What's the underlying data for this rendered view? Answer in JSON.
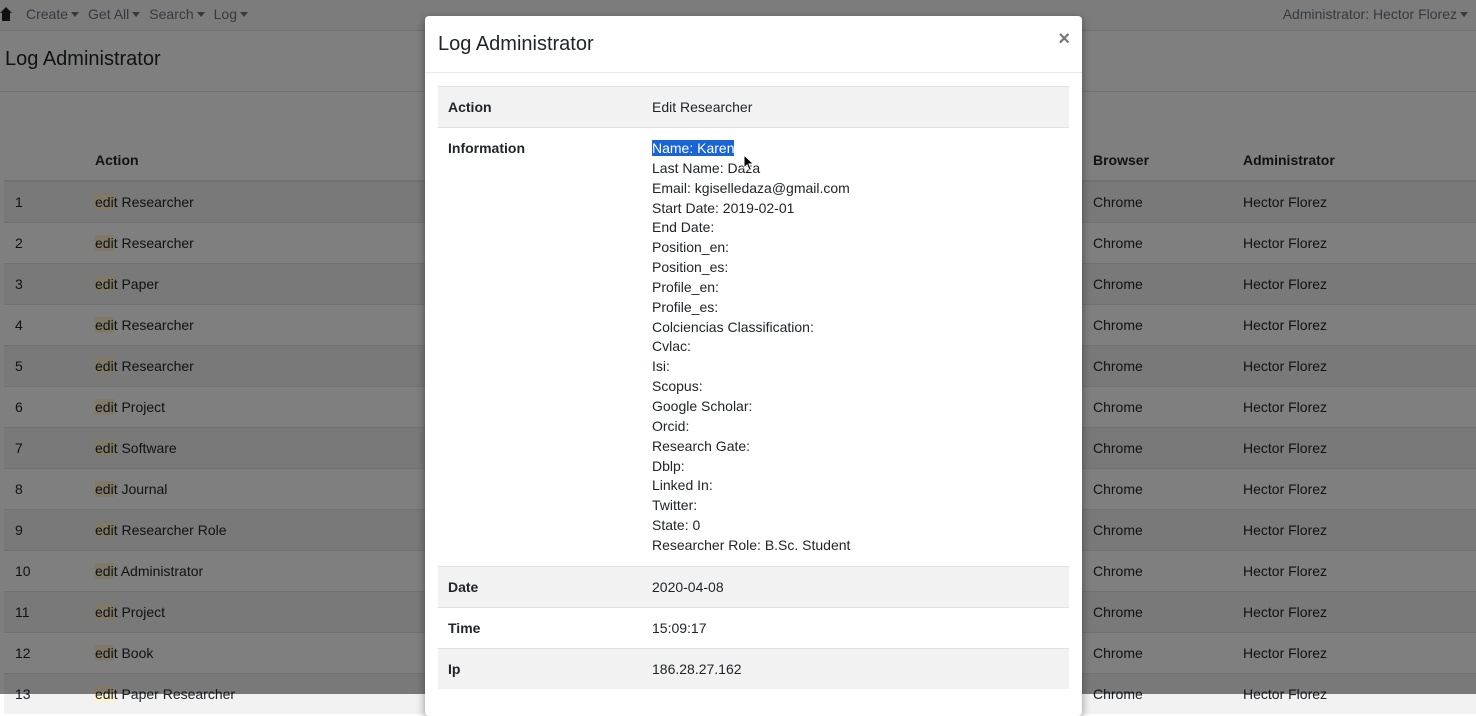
{
  "navbar": {
    "menus": [
      "Create",
      "Get All",
      "Search",
      "Log"
    ],
    "user": "Administrator: Hector Florez"
  },
  "page": {
    "title": "Log Administrator"
  },
  "table": {
    "headers": {
      "action": "Action",
      "browser": "Browser",
      "administrator": "Administrator"
    },
    "rows": [
      {
        "num": "1",
        "prefix": "edi",
        "action": "t Researcher",
        "browser": "Chrome",
        "admin": "Hector Florez"
      },
      {
        "num": "2",
        "prefix": "edi",
        "action": "t Researcher",
        "browser": "Chrome",
        "admin": "Hector Florez"
      },
      {
        "num": "3",
        "prefix": "edi",
        "action": "t Paper",
        "browser": "Chrome",
        "admin": "Hector Florez"
      },
      {
        "num": "4",
        "prefix": "edi",
        "action": "t Researcher",
        "browser": "Chrome",
        "admin": "Hector Florez"
      },
      {
        "num": "5",
        "prefix": "edi",
        "action": "t Researcher",
        "browser": "Chrome",
        "admin": "Hector Florez"
      },
      {
        "num": "6",
        "prefix": "edi",
        "action": "t Project",
        "browser": "Chrome",
        "admin": "Hector Florez"
      },
      {
        "num": "7",
        "prefix": "edi",
        "action": "t Software",
        "browser": "Chrome",
        "admin": "Hector Florez"
      },
      {
        "num": "8",
        "prefix": "edi",
        "action": "t Journal",
        "browser": "Chrome",
        "admin": "Hector Florez"
      },
      {
        "num": "9",
        "prefix": "edi",
        "action": "t Researcher Role",
        "browser": "Chrome",
        "admin": "Hector Florez"
      },
      {
        "num": "10",
        "prefix": "edi",
        "action": "t Administrator",
        "browser": "Chrome",
        "admin": "Hector Florez"
      },
      {
        "num": "11",
        "prefix": "edi",
        "action": "t Project",
        "browser": "Chrome",
        "admin": "Hector Florez"
      },
      {
        "num": "12",
        "prefix": "edi",
        "action": "t Book",
        "browser": "Chrome",
        "admin": "Hector Florez"
      },
      {
        "num": "13",
        "prefix": "edi",
        "action": "t Paper Researcher",
        "browser": "Chrome",
        "admin": "Hector Florez"
      }
    ]
  },
  "modal": {
    "title": "Log Administrator",
    "close": "×",
    "action_label": "Action",
    "action_value": "Edit Researcher",
    "information_label": "Information",
    "information_selected": "Name: Karen",
    "information_lines": [
      "Last Name: Daza",
      "Email: kgiselledaza@gmail.com",
      "Start Date: 2019-02-01",
      "End Date:",
      "Position_en:",
      "Position_es:",
      "Profile_en:",
      "Profile_es:",
      "Colciencias Classification:",
      "Cvlac:",
      "Isi:",
      "Scopus:",
      "Google Scholar:",
      "Orcid:",
      "Research Gate:",
      "Dblp:",
      "Linked In:",
      "Twitter:",
      "State: 0",
      "Researcher Role: B.Sc. Student"
    ],
    "date_label": "Date",
    "date_value": "2020-04-08",
    "time_label": "Time",
    "time_value": "15:09:17",
    "ip_label": "Ip",
    "ip_value": "186.28.27.162"
  },
  "icons": {
    "home": "home-icon",
    "close": "close-icon",
    "cursor": "mouse-cursor-icon",
    "caret": "caret-down-icon"
  },
  "colors": {
    "selection": "#1a64d6",
    "highlight": "#fff3cd",
    "backdrop": "rgba(0,0,0,0.5)"
  }
}
